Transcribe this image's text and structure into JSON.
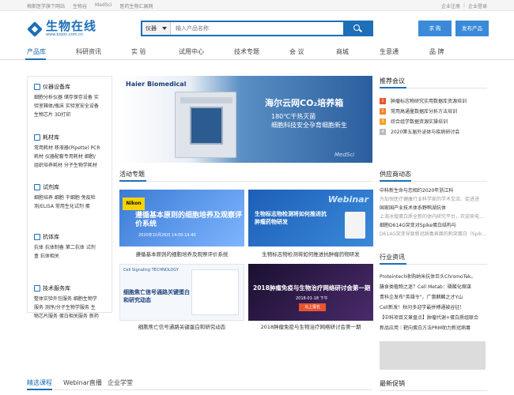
{
  "topbar": {
    "links": [
      "梅斯医学旗下网站",
      "生物谷",
      "MedSci",
      "医药生物汇展网"
    ],
    "register": "企业注册",
    "sep": "|",
    "login": "企业登录"
  },
  "header": {
    "logo_cn": "生物在线",
    "logo_en": "www.bioon.com.cn",
    "search_category": "仪器",
    "search_placeholder": "输入产品名称",
    "btn_buy": "求 购",
    "btn_publish": "发布产品"
  },
  "nav": {
    "items": [
      "产品库",
      "科研资讯",
      "实 验",
      "试用中心",
      "技术专题",
      "会 议",
      "商城",
      "生意通",
      "品 牌"
    ]
  },
  "categories": [
    {
      "title": "仪器设备库",
      "lines": [
        "细胞分析仪器  储存保存设备  实",
        "验室箱体/瓶床  实验室安全设备",
        "生物芯片  3D打印"
      ]
    },
    {
      "title": "耗材库",
      "lines": [
        "常用耗材  移液器(Pipette)  PCR",
        "耗材  仪器配套专用耗材  细胞/",
        "组织培养耗材  分子生物学耗材"
      ]
    },
    {
      "title": "试剂库",
      "lines": [
        "细胞培养  细胞  干细胞  免疫检",
        "测/ELISA  常用生化试剂  蛋"
      ]
    },
    {
      "title": "抗体库",
      "lines": [
        "抗体  抗体制备  第二抗体  试剂",
        "盒  抗体相关"
      ]
    },
    {
      "title": "技术服务库",
      "lines": [
        "整体实验外包服务  细胞生物学",
        "服务  测序/分子生物学服务  生",
        "物芯片服务  蛋白相关服务  新药"
      ]
    }
  ],
  "banner": {
    "brand": "Haier Biomedical",
    "title": "海尔云网CO₂培养箱",
    "line1": "180℃干热灭菌",
    "line2": "细胞科技安全孕育细胞新生",
    "watermark": "MedSci"
  },
  "activity": {
    "title": "活动专题",
    "cards": [
      {
        "img_title": "遵循基本原则的细胞培养及观察评价系统",
        "img_sub": "2020年10月26日 14:00-14:40",
        "brand": "Nikon",
        "caption": "遵循基本原则的细胞培养及观察评价系统"
      },
      {
        "img_title": "生物标志物检测将如何推进抗肿瘤药物研发",
        "img_sub": "Webinar",
        "caption": "生物标志物检测将如何推进抗肿瘤药物研发"
      },
      {
        "img_title": "细胞焦亡信号通路关键蛋白和研究动态",
        "img_sub": "Cell Signaling TECHNOLOGY",
        "caption": "细胞焦亡信号通路关键蛋白和研究动态"
      },
      {
        "img_title": "2018肿瘤免疫与生物治疗网络研讨会第一期",
        "img_sub": "2018-01-18 下午",
        "img_btn": "马上报名",
        "caption": "2018肿瘤免疫与生物治疗网络研讨会第一期"
      }
    ]
  },
  "recommend": {
    "title": "推荐会议",
    "items": [
      {
        "num": "1",
        "text": "肿瘤标志物研究实用数据库资源培训"
      },
      {
        "num": "2",
        "text": "常用高通量数据库分析方法培训"
      },
      {
        "num": "3",
        "text": "综合组学数据资源实操培训"
      },
      {
        "num": "4",
        "text": "2020第五届外泌体与疾病研讨会"
      }
    ],
    "colors": [
      "#e8542f",
      "#f0852d",
      "#f0a12d",
      "#bbbbbb"
    ]
  },
  "supplier": {
    "title": "供应商动态",
    "items": [
      {
        "text": "中科新生命与您相约2020年浙江科",
        "gray": false
      },
      {
        "text": "为加快医疗健康行业科学家的学术交流、促进进",
        "gray": true
      },
      {
        "text": "国家国产业技术体系野鸭湖抗体",
        "gray": false
      },
      {
        "text": "上海冰煌蛋白质全新的体内研究平台，欢迎来电...",
        "gray": true
      },
      {
        "text": "细胞D614G突变对Spike蛋白结构与",
        "gray": false
      },
      {
        "text": "D614G突变导致新冠病毒表面的刺突蛋白（Spik...",
        "gray": true
      }
    ]
  },
  "industry": {
    "title": "行业资讯",
    "items": [
      "Proteintech收购纳米抗体巨头ChromoTek。",
      "膳食类植物之迷？Cell Metab：磷酸化缩谋",
      "青科企发布\"英雄令\"，广惠麒麟之才Y山",
      "Cell新发！秋问多迎学最拼搏通被谷征！",
      "【中科项目文章盘点】肿瘤代谢+蛋白质组联合",
      "新品应用｜靶向蛋白方法PRM助力新冠病毒"
    ]
  },
  "latest": {
    "title": "最新促销"
  },
  "bottom_tabs": [
    "精选课程",
    "Webinar直播",
    "企业学堂"
  ]
}
